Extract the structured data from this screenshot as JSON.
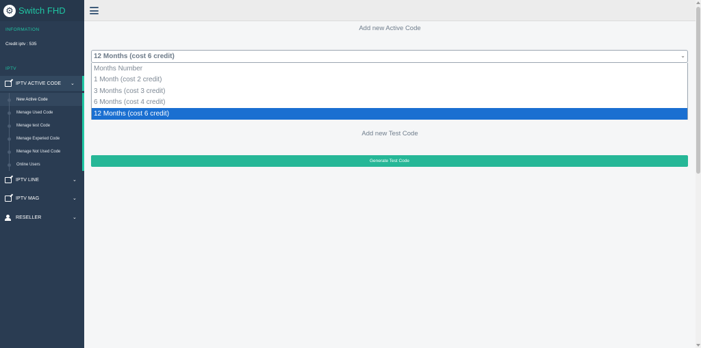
{
  "brand": {
    "title": "Switch FHD",
    "icon": "gear-icon"
  },
  "sidebar": {
    "information_label": "INFORMATION",
    "credit_text": "Credit iptv : 535",
    "iptv_label": "IPTV",
    "menus": [
      {
        "label": "IPTV ACTIVE CODE",
        "icon": "edit-icon",
        "open": true
      },
      {
        "label": "IPTV LINE",
        "icon": "edit-icon",
        "open": false
      },
      {
        "label": "IPTV MAG",
        "icon": "edit-icon",
        "open": false
      },
      {
        "label": "RESELLER",
        "icon": "user-icon",
        "open": false
      }
    ],
    "submenu": [
      {
        "label": "New Active Code",
        "active": true
      },
      {
        "label": "Menage Used Code",
        "active": false
      },
      {
        "label": "Menage test Code",
        "active": false
      },
      {
        "label": "Menage Experied Code",
        "active": false
      },
      {
        "label": "Menage Not Used Code",
        "active": false
      },
      {
        "label": "Online Users",
        "active": false
      }
    ]
  },
  "main": {
    "active_heading": "Add new Active Code",
    "select_value": "12 Months (cost 6 credit)",
    "options": [
      {
        "label": "Months Number",
        "selected": false
      },
      {
        "label": "1 Month (cost 2 credit)",
        "selected": false
      },
      {
        "label": "3 Months (cost 3 credit)",
        "selected": false
      },
      {
        "label": "6 Months (cost 4 credit)",
        "selected": false
      },
      {
        "label": "12 Months (cost 6 credit)",
        "selected": true
      }
    ],
    "test_heading": "Add new Test Code",
    "generate_button": "Generate Test Code"
  },
  "colors": {
    "sidebar": "#2a3c52",
    "accent": "#1fc6a3",
    "button": "#26b797",
    "selected_option": "#1a6fd1"
  }
}
